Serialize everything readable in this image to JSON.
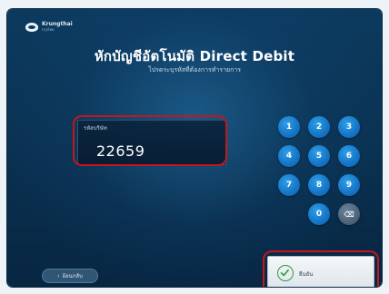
{
  "header": {
    "logo_name": "Krungthai",
    "logo_sub": "กรุงไทย",
    "title": "หักบัญชีอัตโนมัติ Direct Debit",
    "subtitle": "โปรดระบุรหัสที่ต้องการทำรายการ"
  },
  "code_field": {
    "label": "รหัสบริษัท",
    "value": "22659"
  },
  "keypad": {
    "keys": [
      "1",
      "2",
      "3",
      "4",
      "5",
      "6",
      "7",
      "8",
      "9",
      "0",
      "⌫"
    ]
  },
  "footer": {
    "back_label": "ย้อนกลับ",
    "confirm_label": "ยืนยัน"
  },
  "colors": {
    "highlight": "#c4161c",
    "key_blue": "#1677c8",
    "background": "#0a3151"
  }
}
